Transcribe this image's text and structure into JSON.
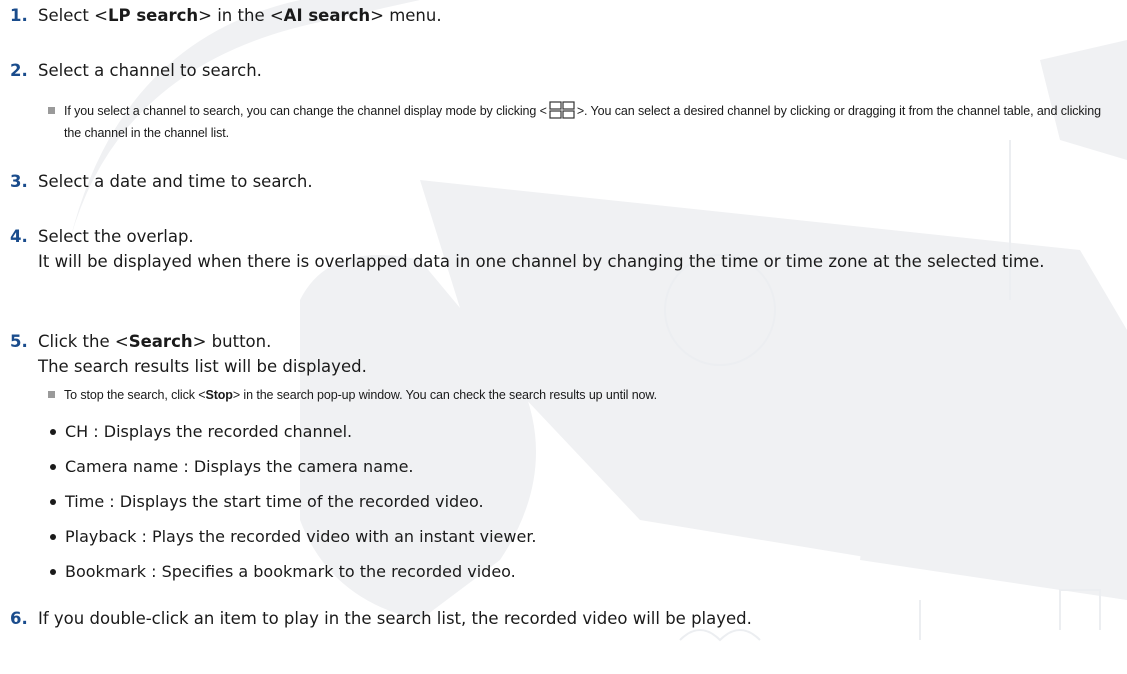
{
  "steps": [
    {
      "num": "1.",
      "t1": "Select <",
      "b1": "LP search",
      "t2": "> in the <",
      "b2": "AI search",
      "t3": "> menu."
    },
    {
      "num": "2.",
      "text": "Select a channel to search."
    },
    {
      "num": "3.",
      "text": "Select a date and time to search."
    },
    {
      "num": "4.",
      "line1": "Select the overlap.",
      "line2": "It will be displayed when there is overlapped data in one channel by changing the time or time zone at the selected time."
    },
    {
      "num": "5.",
      "t1": "Click the <",
      "b1": "Search",
      "t2": "> button.",
      "line2": "The search results list will be displayed."
    },
    {
      "num": "6.",
      "text": "If you double-click an item to play in the search list, the recorded video will be played."
    }
  ],
  "notes": {
    "channel": {
      "t1": "If you select a channel to search, you can change the channel display mode by clicking <",
      "t2": ">. You can select a desired channel by clicking or dragging it from the channel table, and clicking the channel in the channel list."
    },
    "stop": {
      "t1": "To stop the search, click <",
      "b1": "Stop",
      "t2": "> in the search pop-up window. You can check the search results up until now."
    }
  },
  "results_columns": [
    "CH : Displays the recorded channel.",
    "Camera name : Displays the camera name.",
    "Time : Displays the start time of the recorded video.",
    "Playback : Plays the recorded video with an instant viewer.",
    "Bookmark : Specifies a bookmark to the recorded video."
  ],
  "icons": {
    "channel_display_mode": "grid-2x2-icon",
    "watermark": "cctv-camera-watermark"
  },
  "colors": {
    "step_number": "#1a4c8c",
    "text": "#1a1a1a",
    "note_square": "#9a9a9a",
    "watermark": "#f0f1f3"
  }
}
